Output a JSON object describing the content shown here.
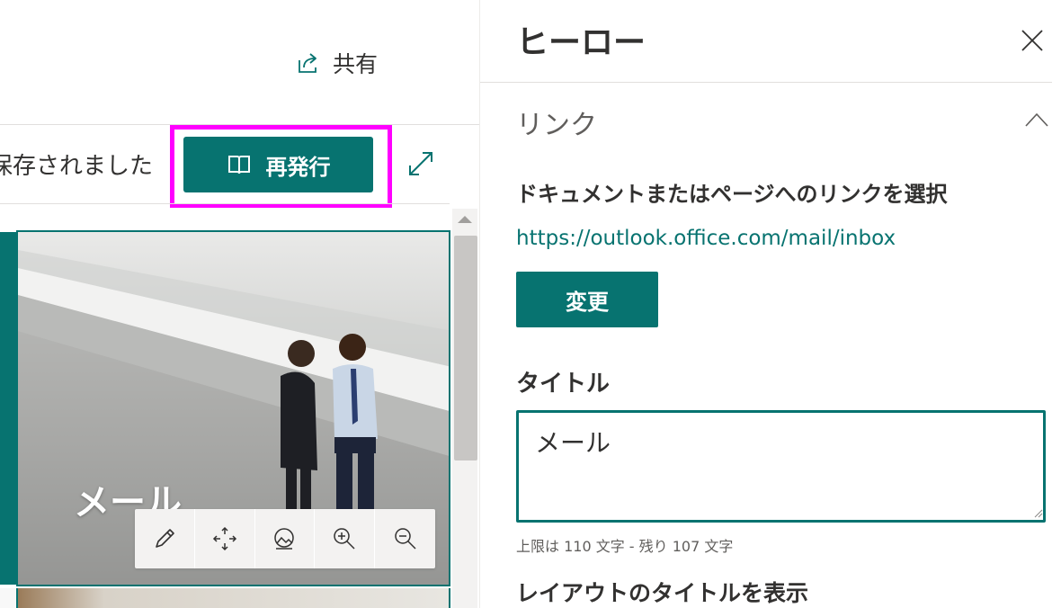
{
  "toolbar": {
    "share_label": "共有",
    "saved_status": "保存されました",
    "republish_label": "再発行"
  },
  "canvas": {
    "hero_title": "メール",
    "image_tools": [
      "edit-icon",
      "focal-point-icon",
      "reset-image-icon",
      "zoom-in-icon",
      "zoom-out-icon"
    ]
  },
  "pane": {
    "title": "ヒーロー",
    "section_link": "リンク",
    "link_heading": "ドキュメントまたはページへのリンクを選択",
    "link_url": "https://outlook.office.com/mail/inbox",
    "change_button": "変更",
    "title_label": "タイトル",
    "title_value": "メール",
    "char_count": "上限は 110 文字 - 残り 107 文字",
    "layout_title_label": "レイアウトのタイトルを表示"
  },
  "colors": {
    "accent": "#077370",
    "highlight": "#ff00ff"
  }
}
